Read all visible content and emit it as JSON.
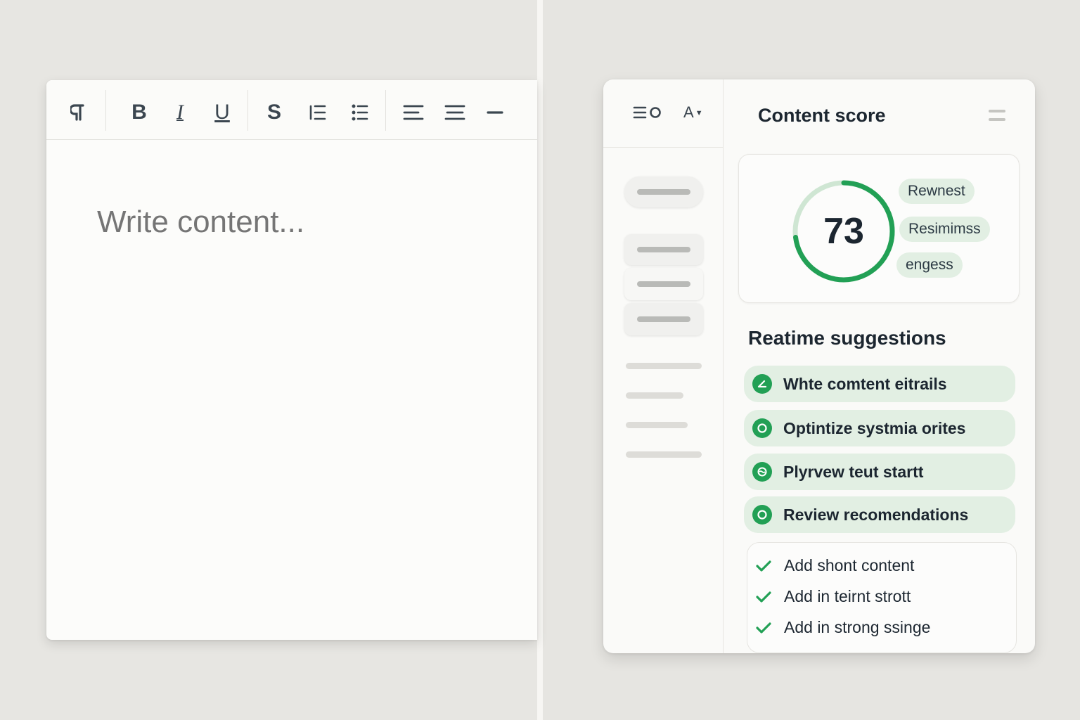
{
  "editor": {
    "placeholder": "Write content...",
    "toolbar": {
      "paragraph_icon": "pilcrow-icon",
      "bold_label": "B",
      "italic_label": "I",
      "underline_label": "U",
      "strike_label": "S",
      "tools": [
        "pilcrow-icon",
        "bold",
        "italic",
        "underline",
        "strikethrough",
        "bulleted-list-icon",
        "numbered-list-icon",
        "align-left-icon",
        "align-center-icon",
        "horizontal-rule-icon"
      ]
    }
  },
  "panel": {
    "toolbar": {
      "view_icon": "list-view-icon",
      "font_label": "A",
      "font_icon": "caret-down-icon"
    },
    "title": "Content score",
    "menu_icon": "menu-icon",
    "score": {
      "value": "73",
      "percent": 73,
      "tags": [
        "Rewnest",
        "Resimimss",
        "engess"
      ]
    },
    "suggestions_title": "Reatime suggestions",
    "suggestions": [
      {
        "label": "Whte comtent eitrails",
        "icon": "edit-icon"
      },
      {
        "label": "Optintize systmia orites",
        "icon": "circle-icon"
      },
      {
        "label": "Plyrvew teut startt",
        "icon": "wave-icon"
      },
      {
        "label": "Review recomendations",
        "icon": "circle-icon"
      }
    ],
    "checklist": [
      "Add shont content",
      "Add in teirnt strott",
      "Add in strong ssinge"
    ],
    "colors": {
      "accent": "#22a055",
      "accent_light": "#e2efe3",
      "track": "#cfe6d3"
    }
  }
}
